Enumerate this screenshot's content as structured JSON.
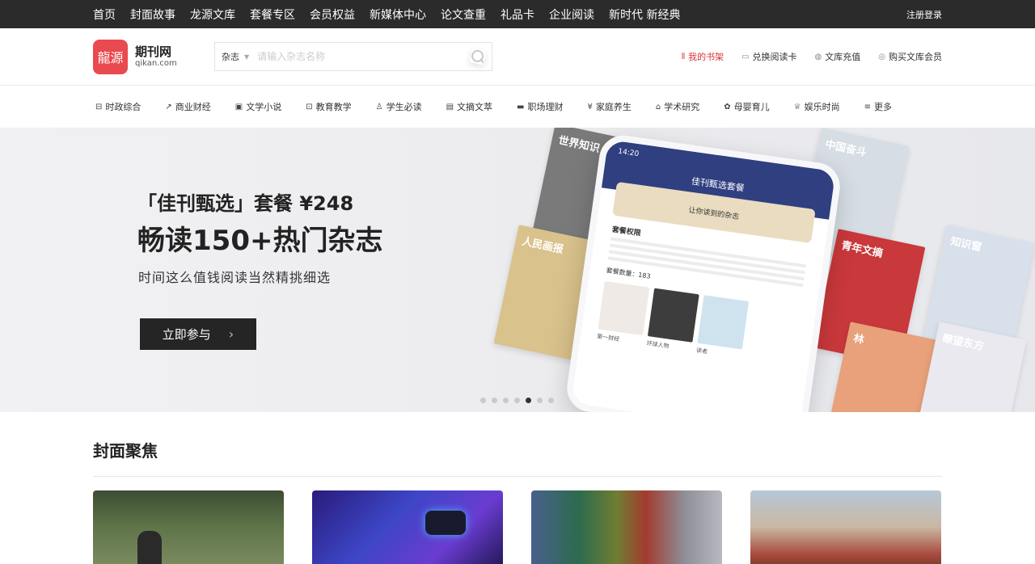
{
  "topbar": {
    "nav": [
      "首页",
      "封面故事",
      "龙源文库",
      "套餐专区",
      "会员权益",
      "新媒体中心",
      "论文查重",
      "礼品卡",
      "企业阅读",
      "新时代 新经典"
    ],
    "login": "注册登录"
  },
  "header": {
    "logo_mark": "龍源",
    "logo_cn": "期刊网",
    "logo_en": "qikan.com",
    "search": {
      "category": "杂志",
      "placeholder": "请输入杂志名称"
    },
    "links": [
      {
        "label": "我的书架",
        "icon": "bookshelf-icon",
        "glyph": "⫴"
      },
      {
        "label": "兑换阅读卡",
        "icon": "card-icon",
        "glyph": "▭"
      },
      {
        "label": "文库充值",
        "icon": "coin-icon",
        "glyph": "◍"
      },
      {
        "label": "购买文库会员",
        "icon": "member-icon",
        "glyph": "◎"
      }
    ],
    "active_color": "#d9333a"
  },
  "categories": [
    {
      "label": "时政综合",
      "glyph": "⊟"
    },
    {
      "label": "商业财经",
      "glyph": "↗"
    },
    {
      "label": "文学小说",
      "glyph": "▣"
    },
    {
      "label": "教育教学",
      "glyph": "⊡"
    },
    {
      "label": "学生必读",
      "glyph": "♙"
    },
    {
      "label": "文摘文萃",
      "glyph": "▤"
    },
    {
      "label": "职场理财",
      "glyph": "▬"
    },
    {
      "label": "家庭养生",
      "glyph": "¥"
    },
    {
      "label": "学术研究",
      "glyph": "⌂"
    },
    {
      "label": "母婴育儿",
      "glyph": "✿"
    },
    {
      "label": "娱乐时尚",
      "glyph": "♕"
    },
    {
      "label": "更多",
      "glyph": "≡"
    }
  ],
  "banner": {
    "line1": "「佳刊甄选」套餐 ¥248",
    "line2": "畅读150+热门杂志",
    "line3": "时间这么值钱阅读当然精挑细选",
    "cta": "立即参与",
    "phone": {
      "time": "14:20",
      "title": "佳刊甄选套餐",
      "card": "让你读到的杂志",
      "section": "套餐权限",
      "count": "套餐数量：183",
      "covers": [
        "第一财经",
        "环球人物",
        "读者"
      ]
    },
    "magazines": [
      "世界知识",
      "读者",
      "中国奋斗",
      "人民画报",
      "青年文摘",
      "知识窗",
      "林",
      "瞭望东方"
    ],
    "dots_total": 7,
    "dot_active": 5
  },
  "section": {
    "title": "封面聚焦"
  }
}
